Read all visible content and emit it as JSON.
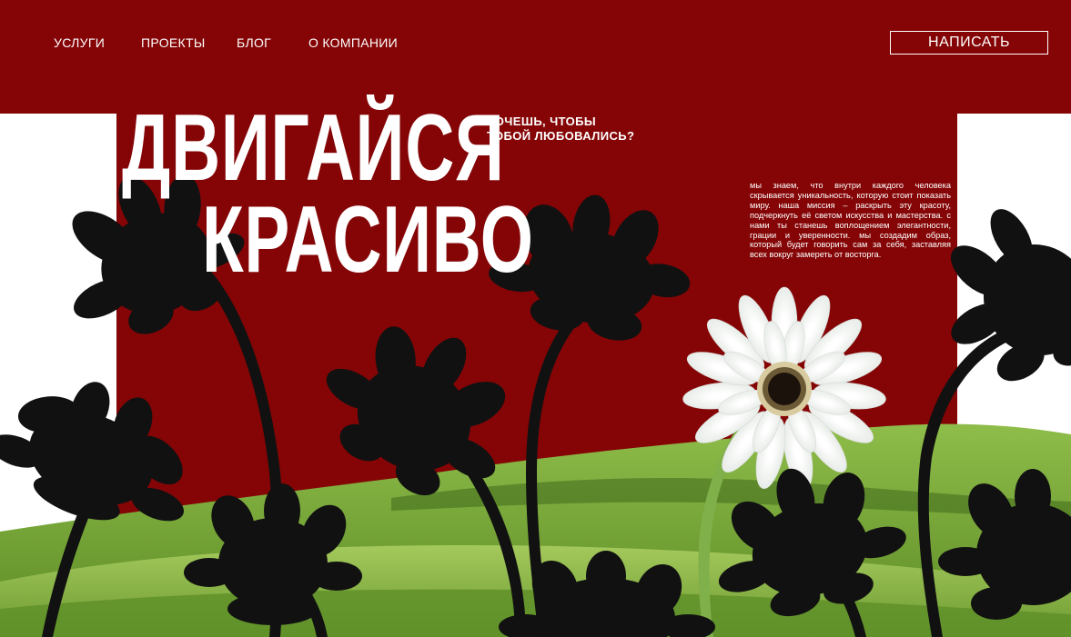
{
  "nav": {
    "items": [
      {
        "label": "УСЛУГИ"
      },
      {
        "label": "ПРОЕКТЫ"
      },
      {
        "label": "БЛОГ"
      },
      {
        "label": "О КОМПАНИИ"
      }
    ],
    "cta_label": "НАПИСАТЬ"
  },
  "hero": {
    "headline_line1": "ДВИГАЙСЯ",
    "headline_line2": "КРАСИВО",
    "subheading_line1": "ХОЧЕШЬ, ЧТОБЫ",
    "subheading_line2": "ТОБОЙ ЛЮБОВАЛИСЬ?",
    "description": "мы знаем, что внутри каждого человека скрывается уникальность, которую стоит показать миру. наша миссия – раскрыть эту красоту, подчеркнуть её светом искусства и мастерства. с нами ты станешь воплощением элегантности, грации и уверенности. мы создадим образ, который будет говорить сам за себя, заставляя всех вокруг замереть от восторга."
  },
  "colors": {
    "brand_red": "#850506",
    "text": "#ffffff",
    "silhouette": "#111111",
    "hills": "#6f9e35"
  }
}
